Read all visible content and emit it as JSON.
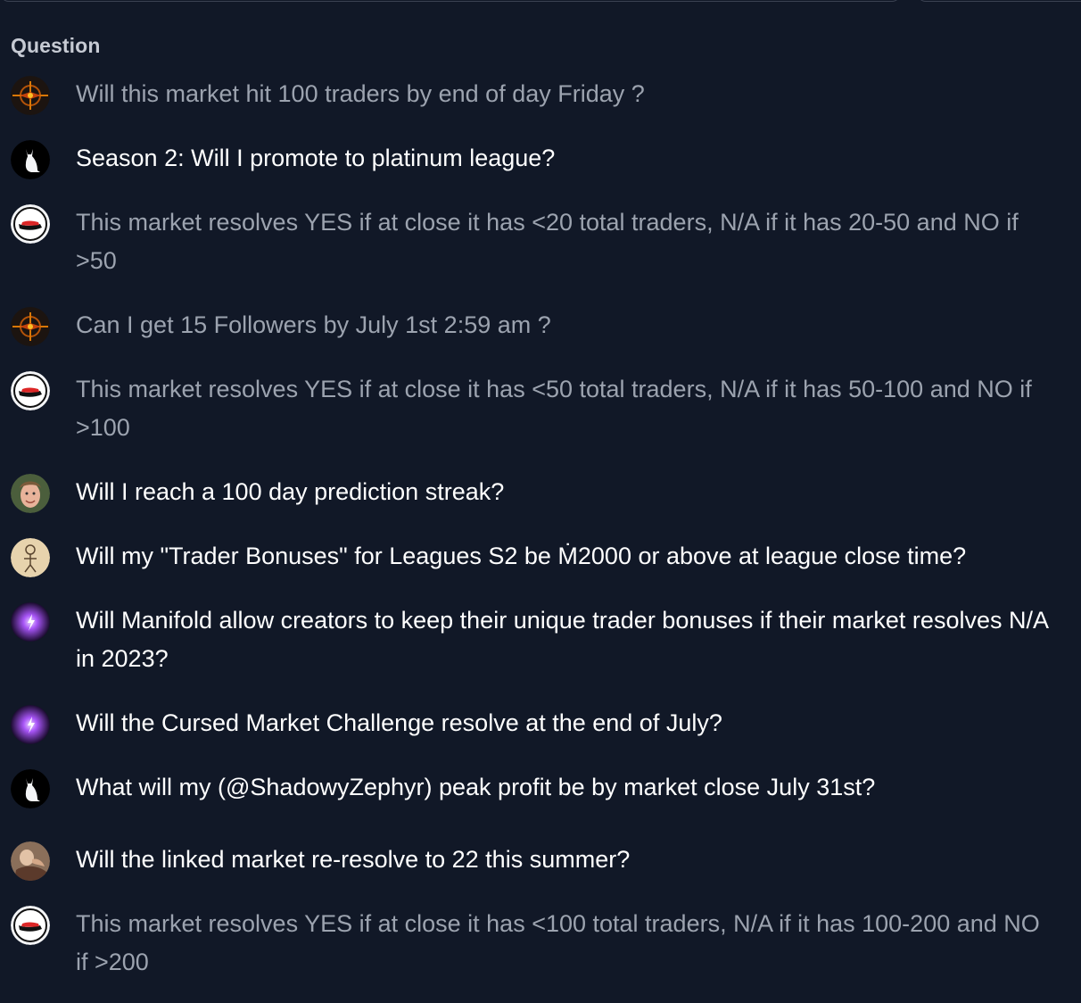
{
  "table": {
    "header": "Question",
    "rows": [
      {
        "avatar": "compass-avatar",
        "text": "Will this market hit 100 traders by end of day Friday ?",
        "resolved": true
      },
      {
        "avatar": "white-cat-avatar",
        "text": "Season 2: Will I promote to platinum league?",
        "resolved": false
      },
      {
        "avatar": "shoe-logo-avatar",
        "text": "This market resolves YES if at close it has <20 total traders, N/A if it has 20-50 and NO if >50",
        "resolved": true
      },
      {
        "avatar": "compass-avatar",
        "text": "Can I get 15 Followers by July 1st 2:59 am ?",
        "resolved": true
      },
      {
        "avatar": "shoe-logo-avatar",
        "text": "This market resolves YES if at close it has <50 total traders, N/A if it has 50-100 and NO if >100",
        "resolved": true
      },
      {
        "avatar": "person-photo-avatar",
        "text": "Will I reach a 100 day prediction streak?",
        "resolved": false
      },
      {
        "avatar": "stick-figure-avatar",
        "text": "Will my \"Trader Bonuses\" for Leagues S2 be Ṁ2000 or above at league close time?",
        "resolved": false
      },
      {
        "avatar": "purple-spark-avatar",
        "text": "Will Manifold allow creators to keep their unique trader bonuses if their market resolves N/A in 2023?",
        "resolved": false
      },
      {
        "avatar": "purple-spark-avatar",
        "text": "Will the Cursed Market Challenge resolve at the end of July?",
        "resolved": false
      },
      {
        "avatar": "white-cat-avatar",
        "text": "What will my (@ShadowyZephyr) peak profit be by market close July 31st?",
        "resolved": false
      },
      {
        "avatar": "painting-avatar",
        "text": "Will the linked market re-resolve to 22 this summer?",
        "resolved": false
      },
      {
        "avatar": "shoe-logo-avatar",
        "text": "This market resolves YES if at close it has <100 total traders, N/A if it has 100-200 and NO if >200",
        "resolved": true
      }
    ]
  },
  "colors": {
    "background": "#111827",
    "resolved_text": "#9ca3af",
    "open_text": "#ffffff",
    "header_text": "#c6cad3"
  }
}
